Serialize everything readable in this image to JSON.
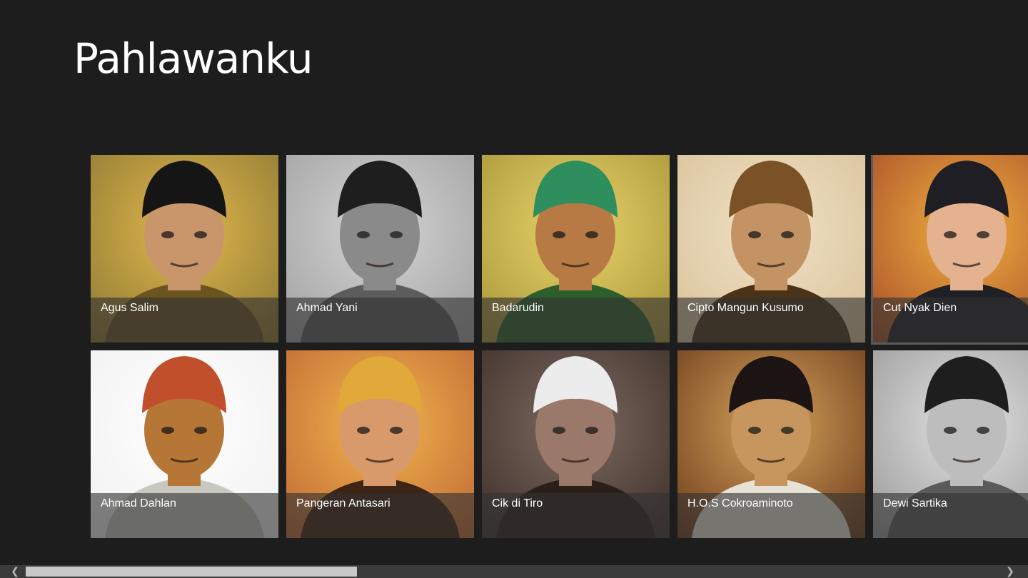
{
  "app": {
    "title": "Pahlawanku"
  },
  "heroes": [
    {
      "name": "Agus Salim",
      "selected": false,
      "colors": {
        "bg1": "#e2b84d",
        "bg2": "#8f7a35",
        "hat": "#151515",
        "skin": "#c9956b",
        "body": "#6b5420"
      }
    },
    {
      "name": "Ahmad Yani",
      "selected": false,
      "colors": {
        "bg1": "#d4d4d4",
        "bg2": "#a2a2a2",
        "hat": "#1e1e1e",
        "skin": "#8a8a8a",
        "body": "#5c5c5c"
      }
    },
    {
      "name": "Badarudin",
      "selected": false,
      "colors": {
        "bg1": "#e9d46a",
        "bg2": "#a9963a",
        "hat": "#2e8e5d",
        "skin": "#b87a45",
        "body": "#2c5f2c"
      }
    },
    {
      "name": "Cipto Mangun Kusumo",
      "selected": false,
      "colors": {
        "bg1": "#f0e2c6",
        "bg2": "#d9c29a",
        "hat": "#7a5226",
        "skin": "#c49364",
        "body": "#4a3318"
      }
    },
    {
      "name": "Cut Nyak Dien",
      "selected": true,
      "colors": {
        "bg1": "#f0b040",
        "bg2": "#a94f2a",
        "hat": "#1e1e24",
        "skin": "#e5b28f",
        "body": "#1f1f26"
      }
    },
    {
      "name": "Ahmad Dahlan",
      "selected": false,
      "colors": {
        "bg1": "#ffffff",
        "bg2": "#f1f1f1",
        "hat": "#c24f2c",
        "skin": "#b67636",
        "body": "#c8c8c0"
      }
    },
    {
      "name": "Pangeran Antasari",
      "selected": false,
      "colors": {
        "bg1": "#f1b54e",
        "bg2": "#c06a35",
        "hat": "#e0a93a",
        "skin": "#d89a6a",
        "body": "#3e2412"
      }
    },
    {
      "name": "Cik di Tiro",
      "selected": false,
      "colors": {
        "bg1": "#7e6b62",
        "bg2": "#3e302a",
        "hat": "#ececec",
        "skin": "#9a786a",
        "body": "#2b1f1a"
      }
    },
    {
      "name": "H.O.S Cokroaminoto",
      "selected": false,
      "colors": {
        "bg1": "#d6a35c",
        "bg2": "#6e3d1c",
        "hat": "#1c1412",
        "skin": "#c7965e",
        "body": "#e6e2d6"
      }
    },
    {
      "name": "Dewi Sartika",
      "selected": false,
      "colors": {
        "bg1": "#e2e2e2",
        "bg2": "#9a9a9a",
        "hat": "#1e1e1e",
        "skin": "#bdbdbd",
        "body": "#5a5a5a"
      }
    }
  ],
  "scroll": {
    "left_icon": "chevron-left-icon",
    "right_icon": "chevron-right-icon",
    "left_glyph": "❮",
    "right_glyph": "❯",
    "position": 0.0
  }
}
